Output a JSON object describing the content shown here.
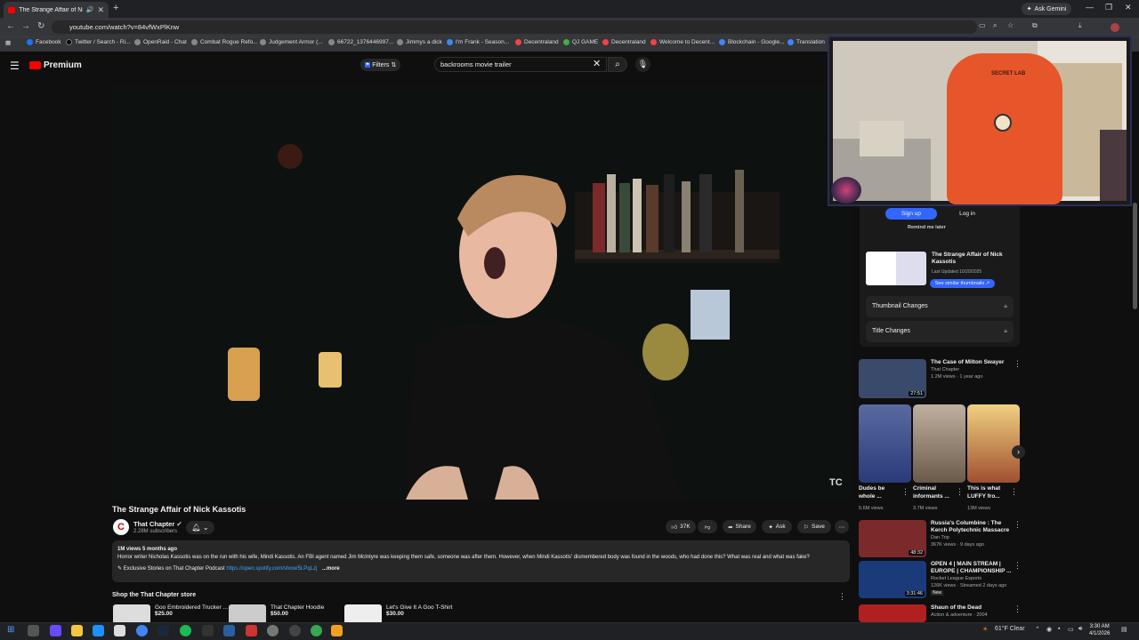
{
  "browser": {
    "tab_title": "The Strange Affair of Nick K",
    "new_tab": "+",
    "ask_gemini": "Ask Gemini",
    "url": "youtube.com/watch?v=84vfWxPlKnw",
    "bookmarks": [
      "Facebook",
      "Twitter / Search - Ri...",
      "OpenRaid - Chat",
      "Combat Rogue Refo...",
      "Judgement Armor (...",
      "66722_1376446997...",
      "Jimmys a dick",
      "I'm Frank - Season...",
      "Decentraland",
      "QJ GAME",
      "Decentraland",
      "Welcome to Decent...",
      "Blockchain - Google...",
      "Translation"
    ]
  },
  "youtube": {
    "brand": "Premium",
    "filters_label": "Filters",
    "search_value": "backrooms movie trailer",
    "video_watermark": "TC",
    "video_title": "The Strange Affair of Nick Kassotis",
    "channel_name": "That Chapter",
    "channel_initial": "C",
    "subscribers": "2.28M subscribers",
    "likes": "37K",
    "share": "Share",
    "ask": "Ask",
    "save": "Save",
    "desc_meta": "1M views  5 months ago",
    "desc_text": "Horror writer Nicholas Kassotis was on the run with his wife, Mindi Kassotis. An FBI agent named Jim McIntyre was keeping them safe, someone was after them. However, when Mindi Kassotis' dismembered body was found in the woods, who had done this? What was real and what was fake?",
    "desc_link_prefix": "Exclusive Stories on That Chapter Podcast",
    "desc_link": "https://open.spotify.com/show/5LPqLzj",
    "desc_more": "...more",
    "store_title": "Shop the That Chapter store",
    "products": [
      {
        "name": "Goo Embroidered Trucker ...",
        "price": "$25.00"
      },
      {
        "name": "That Chapter Hoodie",
        "price": "$50.00"
      },
      {
        "name": "Let's Give It A Goo T-Shirt",
        "price": "$30.00"
      }
    ]
  },
  "extension": {
    "signup": "Sign up",
    "login": "Log in",
    "remind": "Remind me later",
    "title": "The Strange Affair of Nick Kassotis",
    "updated": "Last Updated 10/20/2025",
    "similar_btn": "See similar thumbnails",
    "thumb_changes": "Thumbnail Changes",
    "title_changes": "Title Changes"
  },
  "recommendations": [
    {
      "title": "The Case of Milton Swayer",
      "channel": "That Chapter",
      "meta": "1.2M views · 1 year ago",
      "duration": "27:51",
      "color": "#3a4a6a"
    },
    {
      "title": "Russia's Columbine : The Kerch Polytechnic Massacre",
      "channel": "Dan Trip",
      "meta": "367K views · 9 days ago",
      "duration": "48:32",
      "color": "#7a2a2a"
    },
    {
      "title": "OPEN 4 | MAIN STREAM | EUROPE | CHAMPIONSHIP ...",
      "channel": "Rocket League Esports",
      "meta": "126K views · Streamed 2 days ago",
      "duration": "3:31:46",
      "badge": "New",
      "color": "#1a3a7a"
    },
    {
      "title": "Shaun of the Dead",
      "channel": "Action & adventure · 2004",
      "meta": "",
      "duration": "",
      "color": "#b02020"
    }
  ],
  "shorts": [
    {
      "title": "Dudes be whole ...",
      "views": "5.6M views",
      "color": "#3a4a8a"
    },
    {
      "title": "Criminal informants ...",
      "views": "3.7M views",
      "color": "#8a7a6a"
    },
    {
      "title": "This is what LUFFY fro...",
      "views": "13M views",
      "color": "#d8b060"
    }
  ],
  "camera": {
    "chair_brand": "SECRET LAB"
  },
  "taskbar": {
    "weather": "61°F  Clear",
    "time": "3:30 AM",
    "date": "4/1/2026"
  }
}
